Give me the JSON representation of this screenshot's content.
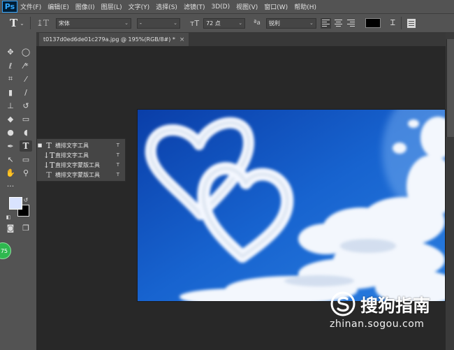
{
  "app": {
    "logo_text": "Ps"
  },
  "menu": [
    "文件(F)",
    "编辑(E)",
    "图像(I)",
    "图层(L)",
    "文字(Y)",
    "选择(S)",
    "滤镜(T)",
    "3D(D)",
    "视图(V)",
    "窗口(W)",
    "帮助(H)"
  ],
  "options": {
    "tool_glyph": "T",
    "font_family": "宋体",
    "font_style": "-",
    "font_size": "72 点",
    "aa_label": "ªa",
    "antialias": "锐利",
    "text_color": "#000000"
  },
  "document": {
    "tab_title": "t0137d0ed6de01c279a.jpg @ 195%(RGB/8#) *",
    "close_glyph": "×"
  },
  "colors": {
    "foreground": "#d9e3ff",
    "background": "#000000",
    "accent_badge": "#2eb84f"
  },
  "badge_text": "75",
  "flyout": {
    "items": [
      {
        "icon": "T",
        "label": "横排文字工具",
        "shortcut": "T",
        "active": true
      },
      {
        "icon": "↓T",
        "label": "直排文字工具",
        "shortcut": "T",
        "active": false
      },
      {
        "icon": "↓T",
        "label": "直排文字蒙版工具",
        "shortcut": "T",
        "active": false
      },
      {
        "icon": "T",
        "label": "横排文字蒙版工具",
        "shortcut": "T",
        "active": false
      }
    ]
  },
  "watermark": {
    "title": "搜狗指南",
    "url": "zhinan.sogou.com"
  },
  "icons": [
    "move-icon",
    "marquee-icon",
    "lasso-icon",
    "magic-wand-icon",
    "crop-icon",
    "eyedropper-icon",
    "healing-brush-icon",
    "brush-icon",
    "stamp-icon",
    "history-brush-icon",
    "eraser-icon",
    "gradient-icon",
    "blur-icon",
    "dodge-icon",
    "pen-icon",
    "type-icon",
    "path-select-icon",
    "rectangle-icon",
    "hand-icon",
    "zoom-icon",
    "more-tools-icon",
    "quickmask-icon",
    "screen-mode-icon"
  ]
}
